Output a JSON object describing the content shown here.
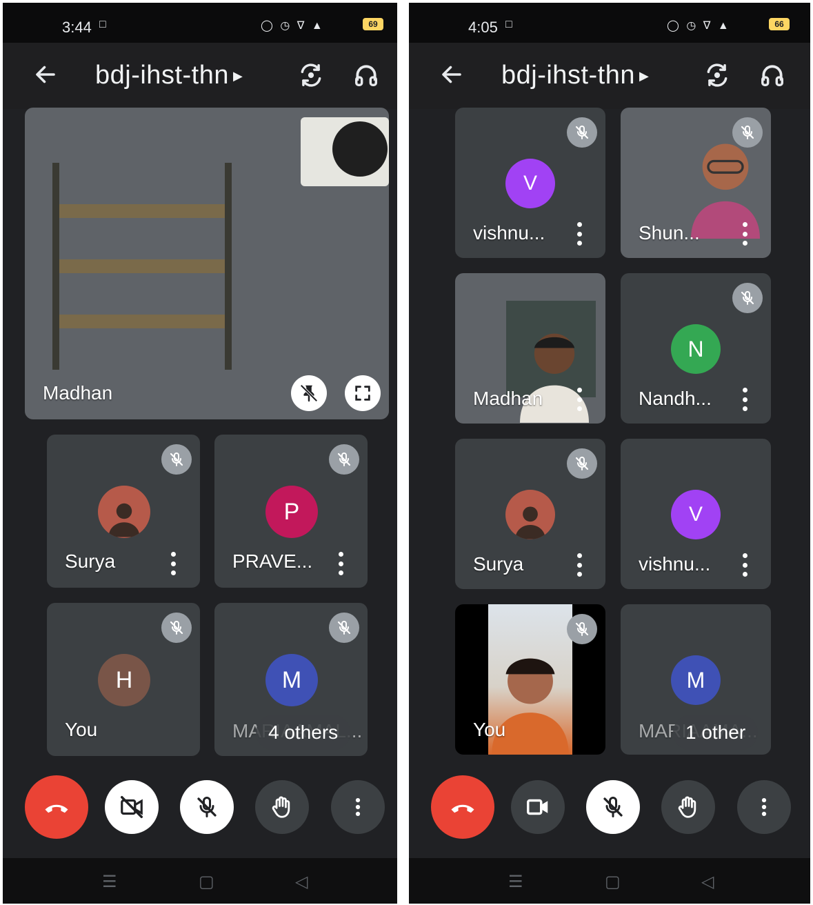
{
  "left_screen": {
    "status": {
      "time": "3:44",
      "battery": "69"
    },
    "meeting_code": "bdj-ihst-thn",
    "featured": {
      "name": "Madhan"
    },
    "participants": [
      {
        "name": "Surya",
        "avatar_letter": "",
        "avatar_color": "#6d5a4a",
        "muted": true
      },
      {
        "name": "PRAVE...",
        "avatar_letter": "P",
        "avatar_color": "#c2185b",
        "muted": true
      },
      {
        "name": "You",
        "avatar_letter": "H",
        "avatar_color": "#795548",
        "muted": true
      },
      {
        "name": "MARIAAMAL...",
        "avatar_letter": "M",
        "avatar_color": "#3f51b5",
        "muted": true
      }
    ],
    "others_label": "4 others"
  },
  "right_screen": {
    "status": {
      "time": "4:05",
      "battery": "66"
    },
    "meeting_code": "bdj-ihst-thn",
    "participants": [
      {
        "name": "vishnu...",
        "avatar_letter": "V",
        "avatar_color": "#a142f4",
        "muted": true
      },
      {
        "name": "Shun...",
        "avatar_letter": "",
        "muted": true
      },
      {
        "name": "Madhan",
        "avatar_letter": "",
        "muted": false
      },
      {
        "name": "Nandh...",
        "avatar_letter": "N",
        "avatar_color": "#34a853",
        "muted": true
      },
      {
        "name": "Surya",
        "avatar_letter": "",
        "avatar_color": "#6d5a4a",
        "muted": true
      },
      {
        "name": "vishnu...",
        "avatar_letter": "V",
        "avatar_color": "#a142f4",
        "muted": false
      },
      {
        "name": "You",
        "avatar_letter": "",
        "muted": true
      },
      {
        "name": "MARIAAMA...",
        "avatar_letter": "M",
        "avatar_color": "#3f51b5",
        "muted": false
      }
    ],
    "others_label": "1 other"
  },
  "icons": {
    "back": "arrow-left-icon",
    "switch_camera": "switch-camera-icon",
    "audio_output": "headphones-icon",
    "end_call": "phone-hangup-icon",
    "camera_off": "video-off-icon",
    "camera_on": "video-icon",
    "mic_off": "mic-off-icon",
    "raise_hand": "hand-icon",
    "more": "more-vert-icon",
    "unpin": "pin-off-icon",
    "fullscreen": "fullscreen-icon"
  },
  "colors": {
    "end_call": "#ea4335",
    "background": "#202124",
    "tile": "#3c4043"
  }
}
